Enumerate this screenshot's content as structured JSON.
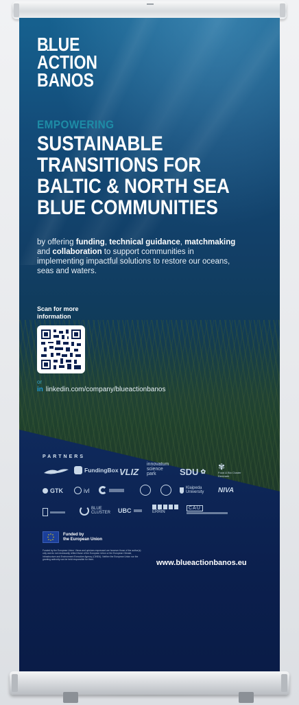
{
  "logo": {
    "line1": "BLUE",
    "line2": "ACTION",
    "line3": "BANOS"
  },
  "hero": {
    "kicker": "EMPOWERING",
    "headline": [
      "SUSTAINABLE",
      "TRANSITIONS FOR",
      "BALTIC & NORTH SEA",
      "BLUE COMMUNITIES"
    ],
    "tagline": {
      "p1": "by offering ",
      "b1": "funding",
      "p2": ", ",
      "b2": "technical guidance",
      "p3": ", ",
      "b3": "matchmaking",
      "p4": " and ",
      "b4": "collaboration",
      "p5": " to support communities in implementing impactful solutions to restore our oceans, seas and waters."
    }
  },
  "contact": {
    "scan_label": "Scan for more information",
    "or": "or",
    "linkedin_icon": "in",
    "linkedin_url": "linkedin.com/company/blueactionbanos"
  },
  "partners": {
    "title": "PARTNERS",
    "fundingbox": "FundingBox",
    "vliz": "VLIZ",
    "innovatum_1": "innovatum",
    "innovatum_2": "science",
    "innovatum_3": "park",
    "sdu": "SDU",
    "food_bio_1": "Food & Bio Cluster",
    "food_bio_2": "Denmark",
    "gtk": "GTK",
    "ivl": "ivl",
    "klaipeda_1": "Klaipeda",
    "klaipeda_2": "University",
    "niva": "NIVA",
    "bluecluster_1": "BLUE",
    "bluecluster_2": "CLUSTER",
    "ubc": "UBC",
    "errin": "ERRIN",
    "cau": "CAU"
  },
  "funding": {
    "line1": "Funded by",
    "line2": "the European Union",
    "disclaimer": "Funded by the European Union. Views and opinions expressed are however those of the author(s) only and do not necessarily reflect those of the European Union or the European Climate, Infrastructure and Environment Executive Agency (CINEA). Neither the European Union nor the granting authority can be held responsible for them."
  },
  "website": "www.blueactionbanos.eu",
  "colors": {
    "accent": "#1e8ca6",
    "navy": "#0c2050",
    "white": "#ffffff"
  }
}
